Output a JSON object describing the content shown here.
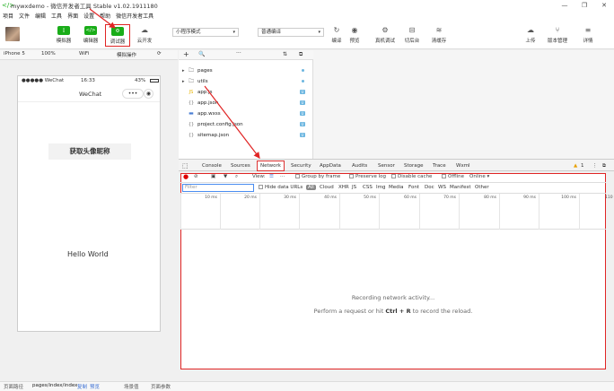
{
  "window": {
    "title": "mywxdemo - 微信开发者工具 Stable v1.02.1911180",
    "controls": [
      "—",
      "❐",
      "✕"
    ]
  },
  "menu": [
    "项目",
    "文件",
    "编辑",
    "工具",
    "界面",
    "设置",
    "帮助",
    "微信开发者工具"
  ],
  "toolbar": {
    "simulator": "模拟器",
    "editor": "编辑器",
    "debugger": "调试器",
    "cloud": "云开发",
    "mode_select": "小程序模式",
    "compile_select": "普通编译",
    "compile": "编译",
    "preview": "预览",
    "remote_debug": "真机调试",
    "cut_bg": "切后台",
    "clear_cache": "清缓存",
    "upload": "上传",
    "version": "版本管理",
    "details": "详情"
  },
  "simbar": {
    "device": "iPhone 5",
    "zoom": "100%",
    "network": "WiFi",
    "sim_action": "模拟操作"
  },
  "phone": {
    "carrier": "●●●●● WeChat",
    "time": "16:33",
    "battery": "43%",
    "nav_title": "WeChat",
    "button_label": "获取头像昵称",
    "hello": "Hello World"
  },
  "tree": [
    {
      "name": "pages",
      "type": "folder",
      "expand": "▸",
      "mark": "dot"
    },
    {
      "name": "utils",
      "type": "folder",
      "expand": "▸",
      "mark": "dot"
    },
    {
      "name": "app.js",
      "type": "js",
      "mark": "U"
    },
    {
      "name": "app.json",
      "type": "json",
      "mark": "U"
    },
    {
      "name": "app.wxss",
      "type": "wxss",
      "mark": "U"
    },
    {
      "name": "project.config.json",
      "type": "json",
      "mark": "U"
    },
    {
      "name": "sitemap.json",
      "type": "json",
      "mark": "U"
    }
  ],
  "tree_toolbar": [
    "+",
    "🔍",
    "···",
    "⇅",
    "⧉"
  ],
  "devtools": {
    "tabs": [
      "Console",
      "Sources",
      "Network",
      "Security",
      "AppData",
      "Audits",
      "Sensor",
      "Storage",
      "Trace",
      "Wxml"
    ],
    "active_tab": "Network",
    "warn_count": "1",
    "net_toolbar": {
      "view": "View:",
      "group_by_frame": "Group by frame",
      "preserve_log": "Preserve log",
      "disable_cache": "Disable cache",
      "offline": "Offline",
      "online": "Online"
    },
    "filter_placeholder": "Filter",
    "hide_data_urls": "Hide data URLs",
    "types": [
      "All",
      "Cloud",
      "XHR",
      "JS",
      "CSS",
      "Img",
      "Media",
      "Font",
      "Doc",
      "WS",
      "Manifest",
      "Other"
    ],
    "ticks": [
      "10 ms",
      "20 ms",
      "30 ms",
      "40 ms",
      "50 ms",
      "60 ms",
      "70 ms",
      "80 ms",
      "90 ms",
      "100 ms",
      "110"
    ],
    "recording": "Recording network activity...",
    "hint_prefix": "Perform a request or hit ",
    "hint_key": "Ctrl + R",
    "hint_suffix": " to record the reload."
  },
  "status": {
    "path_label": "页面路径",
    "path": "pages/index/index",
    "copy": "复制",
    "preview": "预览",
    "scene": "场景值",
    "params": "页面参数"
  },
  "colors": {
    "green": "#1aad19",
    "annotation_red": "#e02424"
  }
}
